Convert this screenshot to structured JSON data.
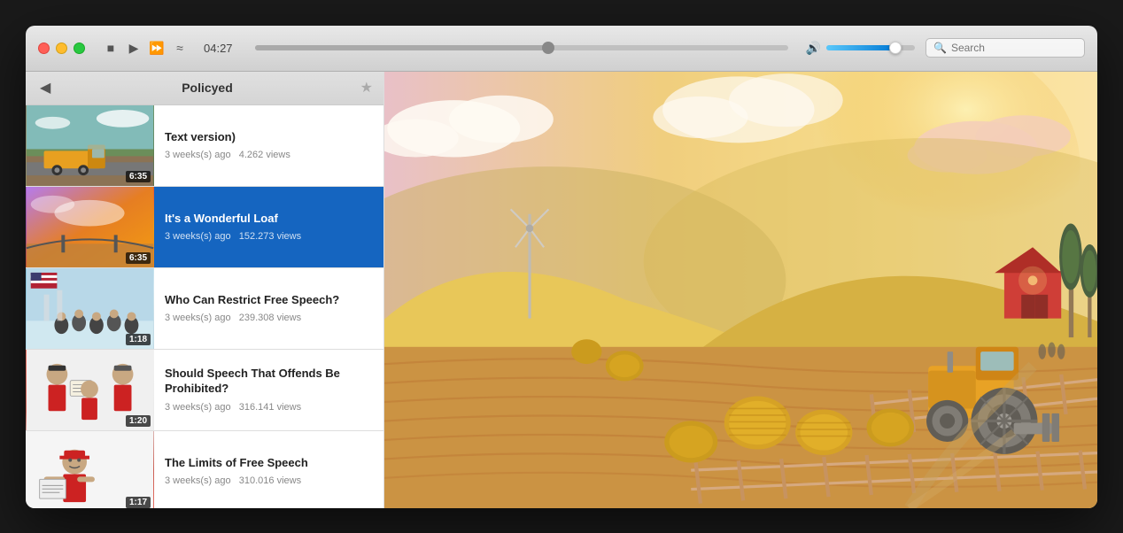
{
  "window": {
    "title": "Policyed",
    "search_placeholder": "Search"
  },
  "titlebar": {
    "time": "04:27",
    "progress_pct": 55,
    "volume_pct": 78,
    "traffic_lights": {
      "close": "close",
      "minimize": "minimize",
      "maximize": "maximize"
    },
    "controls": {
      "stop_label": "■",
      "play_label": "▶",
      "forward_label": "⏩",
      "wave_label": "≈"
    }
  },
  "sidebar": {
    "title": "Policyed",
    "back_label": "◀",
    "star_label": "★",
    "videos": [
      {
        "id": 1,
        "title": "Text version)",
        "age": "3 weeks(s) ago",
        "views": "4.262 views",
        "duration": "6:35",
        "active": false,
        "thumb_class": "thumb-1"
      },
      {
        "id": 2,
        "title": "It's a Wonderful Loaf",
        "age": "3 weeks(s) ago",
        "views": "152.273 views",
        "duration": "6:35",
        "active": true,
        "thumb_class": "thumb-2"
      },
      {
        "id": 3,
        "title": "Who Can Restrict Free Speech?",
        "age": "3 weeks(s) ago",
        "views": "239.308 views",
        "duration": "1:18",
        "active": false,
        "thumb_class": "thumb-3"
      },
      {
        "id": 4,
        "title": "Should Speech That Offends Be Prohibited?",
        "age": "3 weeks(s) ago",
        "views": "316.141 views",
        "duration": "1:20",
        "active": false,
        "thumb_class": "thumb-4"
      },
      {
        "id": 5,
        "title": "The Limits of Free Speech",
        "age": "3 weeks(s) ago",
        "views": "310.016 views",
        "duration": "1:17",
        "active": false,
        "thumb_class": "thumb-5"
      }
    ]
  }
}
